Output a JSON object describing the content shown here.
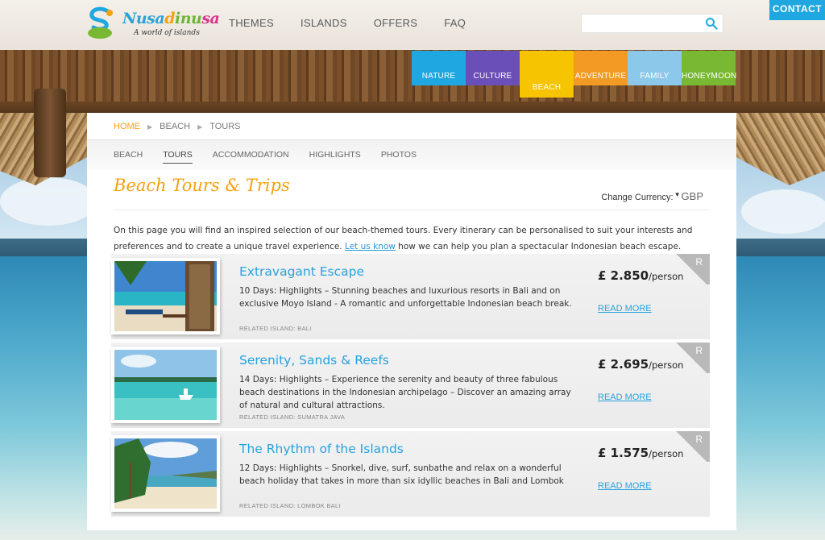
{
  "header": {
    "logo_name_parts": [
      "Nusa",
      "d",
      "inu",
      "sa"
    ],
    "logo_tagline": "A world of islands",
    "nav": [
      "THEMES",
      "ISLANDS",
      "OFFERS",
      "FAQ"
    ],
    "search": {
      "value": "",
      "placeholder": ""
    },
    "contact_label": "CONTACT"
  },
  "categories": [
    {
      "label": "NATURE",
      "color": "#1fa7e1",
      "active": false
    },
    {
      "label": "CULTURE",
      "color": "#6b4fb8",
      "active": false
    },
    {
      "label": "BEACH",
      "color": "#f6c400",
      "active": true
    },
    {
      "label": "ADVENTURE",
      "color": "#f29a23",
      "active": false
    },
    {
      "label": "FAMILY",
      "color": "#8cc8ea",
      "active": false
    },
    {
      "label": "HONEYMOON",
      "color": "#79b833",
      "active": false
    }
  ],
  "breadcrumb": [
    "HOME",
    "BEACH",
    "TOURS"
  ],
  "subnav": [
    "BEACH",
    "TOURS",
    "ACCOMMODATION",
    "HIGHLIGHTS",
    "PHOTOS"
  ],
  "subnav_active": "TOURS",
  "page_title": "Beach Tours & Trips",
  "currency": {
    "label": "Change Currency:",
    "code": "GBP"
  },
  "intro": {
    "before": "On this page you will find an inspired selection of our beach-themed tours. Every itinerary can be personalised to suit your interests and preferences and to create a unique travel experience. ",
    "link": "Let us know",
    "after": " how we can help you plan a spectacular Indonesian beach escape."
  },
  "tours": [
    {
      "title": "Extravagant Escape",
      "desc": "10 Days: Highlights – Stunning beaches and luxurious resorts in Bali and on exclusive Moyo Island - A romantic and unforgettable Indonesian beach break.",
      "related": "RELATED ISLAND: BALI",
      "price": "£ 2.850",
      "per": "/person",
      "more": "READ MORE",
      "badge": "R"
    },
    {
      "title": "Serenity, Sands & Reefs",
      "desc": "14 Days: Highlights – Experience the serenity and beauty of three fabulous beach destinations in the Indonesian archipelago – Discover an amazing array of natural and cultural attractions.",
      "related": "RELATED ISLAND: SUMATRA JAVA",
      "price": "£ 2.695",
      "per": "/person",
      "more": "READ MORE",
      "badge": "R"
    },
    {
      "title": "The Rhythm of the Islands",
      "desc": "12 Days: Highlights – Snorkel, dive, surf, sunbathe and relax on a wonderful beach holiday that takes in more than six idyllic beaches in Bali and Lombok",
      "related": "RELATED ISLAND: LOMBOK BALI",
      "price": "£ 1.575",
      "per": "/person",
      "more": "READ MORE",
      "badge": "R"
    }
  ]
}
